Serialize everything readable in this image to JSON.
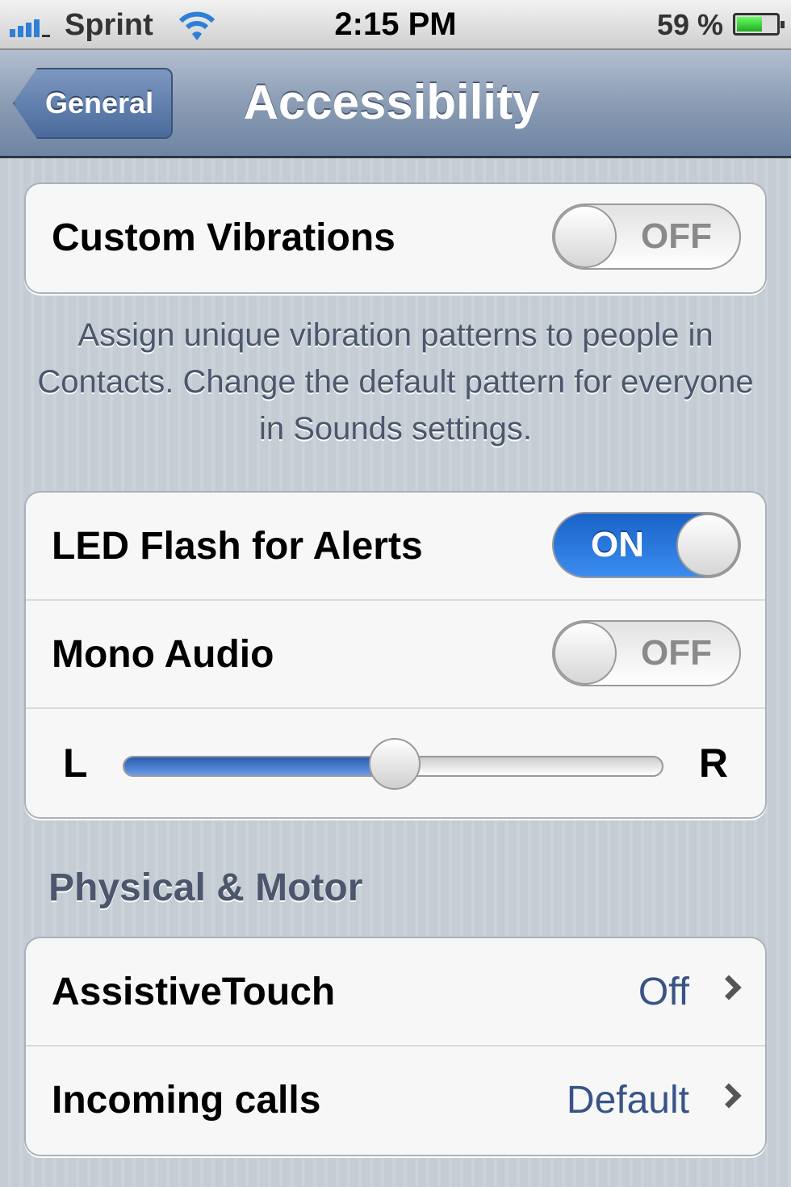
{
  "status_bar": {
    "carrier": "Sprint",
    "time": "2:15 PM",
    "battery": "59 %",
    "battery_level": 0.59,
    "signal_bars": 4,
    "icons": [
      "signal-icon",
      "wifi-icon",
      "battery-icon"
    ]
  },
  "nav": {
    "back_label": "General",
    "title": "Accessibility"
  },
  "group1": {
    "custom_vibrations": {
      "label": "Custom Vibrations",
      "state": "OFF"
    }
  },
  "vibrations_footer": "Assign unique vibration patterns to people in Contacts. Change the default pattern for everyone in Sounds settings.",
  "group2": {
    "led_flash": {
      "label": "LED Flash for Alerts",
      "state": "ON"
    },
    "mono_audio": {
      "label": "Mono Audio",
      "state": "OFF"
    },
    "balance": {
      "left": "L",
      "right": "R",
      "value": 0.5
    }
  },
  "section_physical": "Physical & Motor",
  "group3": {
    "assistive_touch": {
      "label": "AssistiveTouch",
      "value": "Off"
    },
    "incoming_calls": {
      "label": "Incoming calls",
      "value": "Default"
    }
  },
  "colors": {
    "accent": "#2e7fd6",
    "value_text": "#385487",
    "toggle_on": "#1a63c8"
  }
}
